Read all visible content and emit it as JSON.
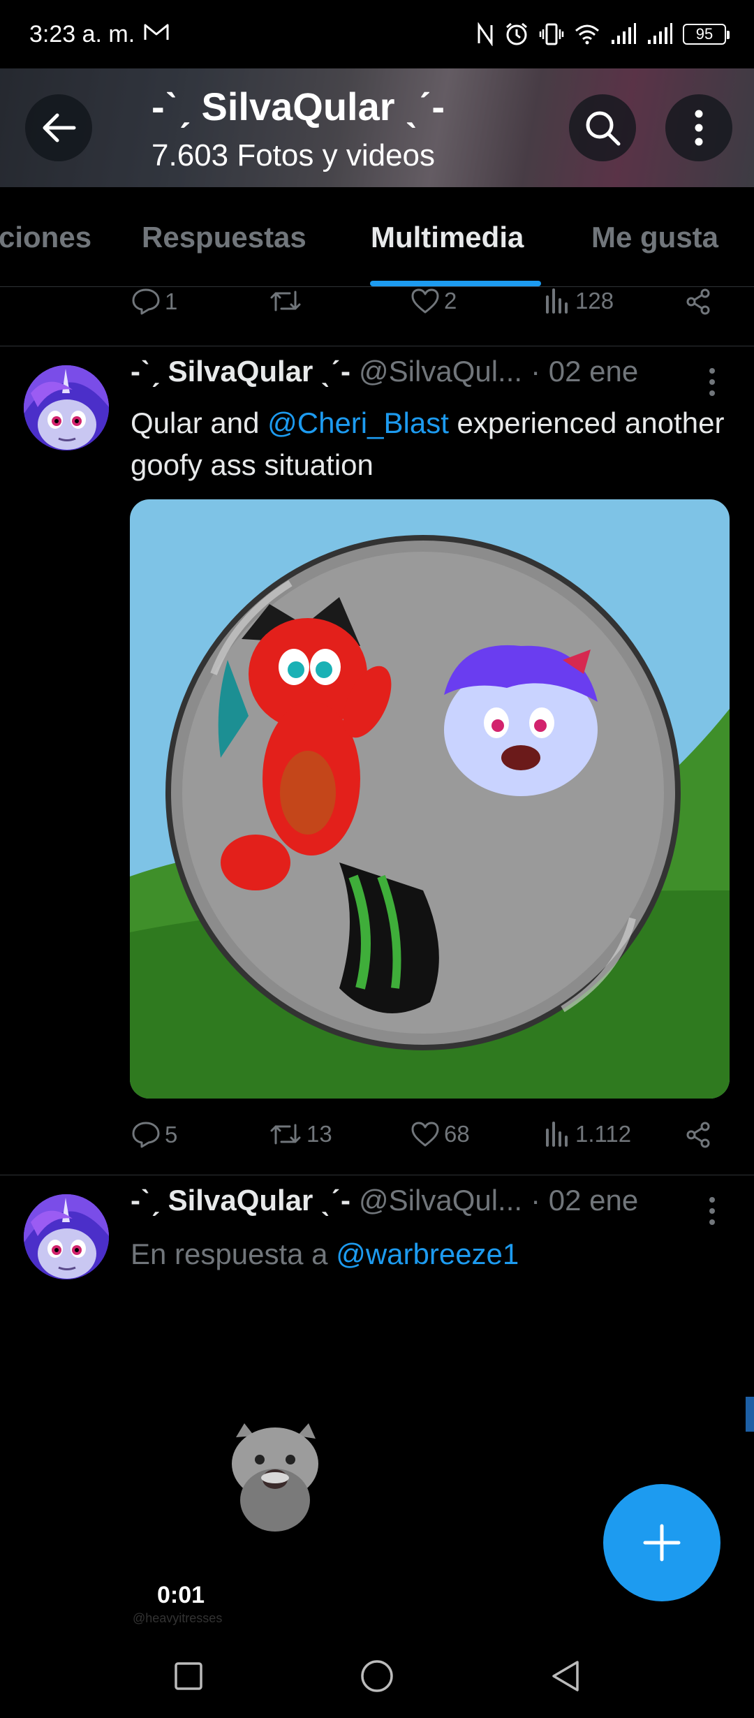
{
  "status_bar": {
    "time": "3:23 a. m.",
    "battery": "95",
    "icons": [
      "mail-icon",
      "nfc-icon",
      "alarm-icon",
      "vibrate-icon",
      "wifi-icon",
      "signal-icon",
      "signal-icon",
      "battery-icon"
    ]
  },
  "header": {
    "title": "-ˋˏ SilvaQular ˎˊ-",
    "subtitle": "7.603 Fotos y videos"
  },
  "tabs": [
    {
      "label": "ciones"
    },
    {
      "label": "Respuestas"
    },
    {
      "label": "Multimedia",
      "active": true
    },
    {
      "label": "Me gusta"
    }
  ],
  "prev_tweet_actions": {
    "replies": "1",
    "retweets": "",
    "likes": "2",
    "views": "128"
  },
  "tweets": [
    {
      "name": "-ˋˏ SilvaQular ˎˊ-",
      "handle": "@SilvaQul...",
      "date": "· 02 ene",
      "text_before": "Qular and ",
      "mention": "@Cheri_Blast",
      "text_after": " experienced another goofy ass situation",
      "actions": {
        "replies": "5",
        "retweets": "13",
        "likes": "68",
        "views": "1.112"
      }
    },
    {
      "name": "-ˋˏ SilvaQular ˎˊ-",
      "handle": "@SilvaQul...",
      "date": "· 02 ene",
      "reply_prefix": "En respuesta a ",
      "reply_to": "@warbreeze1",
      "video_time": "0:01",
      "video_watermark": "@heavyitresses"
    }
  ],
  "colors": {
    "accent": "#1d9bf0",
    "background": "#000000",
    "secondary_text": "#71767b",
    "divider": "#2f3336"
  }
}
